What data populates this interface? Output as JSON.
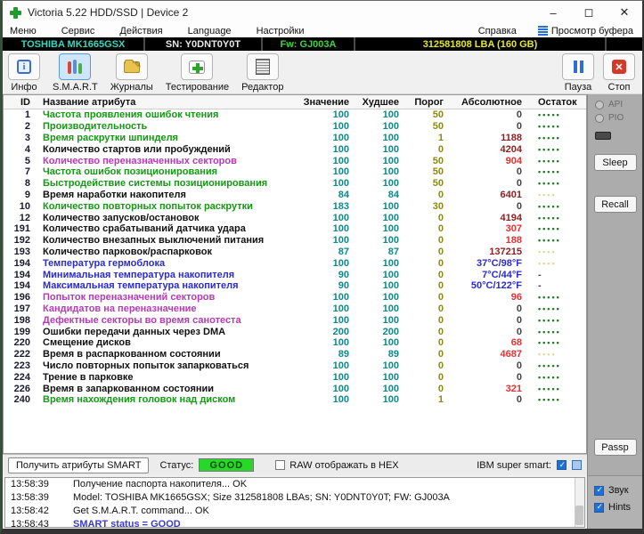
{
  "window": {
    "title": "Victoria 5.22 HDD/SSD | Device 2",
    "minimize": "–",
    "maximize": "◻",
    "close": "✕"
  },
  "menu": {
    "items": [
      "Меню",
      "Сервис",
      "Действия",
      "Language",
      "Настройки"
    ],
    "help": "Справка",
    "buffer_view": "Просмотр буфера"
  },
  "device_bar": {
    "model": "TOSHIBA MK1665GSX",
    "serial": "SN: Y0DNT0Y0T",
    "firmware": "Fw: GJ003A",
    "capacity": "312581808 LBA (160 GB)"
  },
  "toolbar": {
    "buttons": [
      {
        "label": "Инфо"
      },
      {
        "label": "S.M.A.R.T",
        "selected": true
      },
      {
        "label": "Журналы"
      },
      {
        "label": "Тестирование"
      },
      {
        "label": "Редактор"
      }
    ],
    "pause_label": "Пауза",
    "stop_label": "Стоп"
  },
  "smart_table": {
    "columns": [
      "ID",
      "Название атрибута",
      "Значение",
      "Худшее",
      "Порог",
      "Абсолютное",
      "Остаток"
    ],
    "rows": [
      {
        "id": 1,
        "name": "Частота проявления ошибок чтения",
        "name_color": "green",
        "value": 100,
        "worst": 100,
        "threshold": 50,
        "absolute": "0",
        "abs_color": "dark",
        "remain": "g5"
      },
      {
        "id": 2,
        "name": "Производительность",
        "name_color": "green",
        "value": 100,
        "worst": 100,
        "threshold": 50,
        "absolute": "0",
        "abs_color": "dark",
        "remain": "g5"
      },
      {
        "id": 3,
        "name": "Время раскрутки шпинделя",
        "name_color": "green",
        "value": 100,
        "worst": 100,
        "threshold": 1,
        "absolute": "1188",
        "abs_color": "maroon",
        "remain": "g5"
      },
      {
        "id": 4,
        "name": "Количество стартов или пробуждений",
        "name_color": "black",
        "value": 100,
        "worst": 100,
        "threshold": 0,
        "absolute": "4204",
        "abs_color": "maroon",
        "remain": "g5"
      },
      {
        "id": 5,
        "name": "Количество переназначенных секторов",
        "name_color": "magenta",
        "value": 100,
        "worst": 100,
        "threshold": 50,
        "absolute": "904",
        "abs_color": "red",
        "remain": "g5"
      },
      {
        "id": 7,
        "name": "Частота ошибок позиционирования",
        "name_color": "green",
        "value": 100,
        "worst": 100,
        "threshold": 50,
        "absolute": "0",
        "abs_color": "dark",
        "remain": "g5"
      },
      {
        "id": 8,
        "name": "Быстродействие системы позиционирования",
        "name_color": "green",
        "value": 100,
        "worst": 100,
        "threshold": 50,
        "absolute": "0",
        "abs_color": "dark",
        "remain": "g5"
      },
      {
        "id": 9,
        "name": "Время наработки накопителя",
        "name_color": "black",
        "value": 84,
        "worst": 84,
        "threshold": 0,
        "absolute": "6401",
        "abs_color": "maroon",
        "remain": "y4"
      },
      {
        "id": 10,
        "name": "Количество повторных попыток раскрутки",
        "name_color": "green",
        "value": 183,
        "worst": 100,
        "threshold": 30,
        "absolute": "0",
        "abs_color": "dark",
        "remain": "g5"
      },
      {
        "id": 12,
        "name": "Количество запусков/остановок",
        "name_color": "black",
        "value": 100,
        "worst": 100,
        "threshold": 0,
        "absolute": "4194",
        "abs_color": "maroon",
        "remain": "g5"
      },
      {
        "id": 191,
        "name": "Количество срабатываний датчика удара",
        "name_color": "black",
        "value": 100,
        "worst": 100,
        "threshold": 0,
        "absolute": "307",
        "abs_color": "red",
        "remain": "g5"
      },
      {
        "id": 192,
        "name": "Количество внезапных выключений питания",
        "name_color": "black",
        "value": 100,
        "worst": 100,
        "threshold": 0,
        "absolute": "188",
        "abs_color": "red",
        "remain": "g5"
      },
      {
        "id": 193,
        "name": "Количество парковок/распарковок",
        "name_color": "black",
        "value": 87,
        "worst": 87,
        "threshold": 0,
        "absolute": "137215",
        "abs_color": "maroon",
        "remain": "y4"
      },
      {
        "id": 194,
        "name": "Температура гермоблока",
        "name_color": "blue",
        "value": 100,
        "worst": 100,
        "threshold": 0,
        "absolute": "37°C/98°F",
        "abs_color": "blue",
        "remain": "y4"
      },
      {
        "id": 194,
        "name": "Минимальная температура накопителя",
        "name_color": "blue",
        "value": 90,
        "worst": 100,
        "threshold": 0,
        "absolute": "7°C/44°F",
        "abs_color": "blue",
        "remain": "dash"
      },
      {
        "id": 194,
        "name": "Максимальная температура накопителя",
        "name_color": "blue",
        "value": 90,
        "worst": 100,
        "threshold": 0,
        "absolute": "50°C/122°F",
        "abs_color": "blue",
        "remain": "dash"
      },
      {
        "id": 196,
        "name": "Попыток переназначений секторов",
        "name_color": "magenta",
        "value": 100,
        "worst": 100,
        "threshold": 0,
        "absolute": "96",
        "abs_color": "red",
        "remain": "g5"
      },
      {
        "id": 197,
        "name": "Кандидатов на переназначение",
        "name_color": "magenta",
        "value": 100,
        "worst": 100,
        "threshold": 0,
        "absolute": "0",
        "abs_color": "dark",
        "remain": "g5"
      },
      {
        "id": 198,
        "name": "Дефектные секторы во время санотеста",
        "name_color": "magenta",
        "value": 100,
        "worst": 100,
        "threshold": 0,
        "absolute": "0",
        "abs_color": "dark",
        "remain": "g5"
      },
      {
        "id": 199,
        "name": "Ошибки передачи данных через DMA",
        "name_color": "black",
        "value": 200,
        "worst": 200,
        "threshold": 0,
        "absolute": "0",
        "abs_color": "dark",
        "remain": "g5"
      },
      {
        "id": 220,
        "name": "Смещение дисков",
        "name_color": "black",
        "value": 100,
        "worst": 100,
        "threshold": 0,
        "absolute": "68",
        "abs_color": "red",
        "remain": "g5"
      },
      {
        "id": 222,
        "name": "Время в распаркованном состоянии",
        "name_color": "black",
        "value": 89,
        "worst": 89,
        "threshold": 0,
        "absolute": "4687",
        "abs_color": "red",
        "remain": "y4"
      },
      {
        "id": 223,
        "name": "Число повторных попыток запарковаться",
        "name_color": "black",
        "value": 100,
        "worst": 100,
        "threshold": 0,
        "absolute": "0",
        "abs_color": "dark",
        "remain": "g5"
      },
      {
        "id": 224,
        "name": "Трение в парковке",
        "name_color": "black",
        "value": 100,
        "worst": 100,
        "threshold": 0,
        "absolute": "0",
        "abs_color": "dark",
        "remain": "g5"
      },
      {
        "id": 226,
        "name": "Время в запаркованном состоянии",
        "name_color": "black",
        "value": 100,
        "worst": 100,
        "threshold": 0,
        "absolute": "321",
        "abs_color": "red",
        "remain": "g5"
      },
      {
        "id": 240,
        "name": "Время нахождения головок над диском",
        "name_color": "green",
        "value": 100,
        "worst": 100,
        "threshold": 1,
        "absolute": "0",
        "abs_color": "dark",
        "remain": "g5"
      }
    ]
  },
  "right_panel": {
    "radio_api": "API",
    "radio_pio": "PIO",
    "sleep_button": "Sleep",
    "recall_button": "Recall",
    "passp_button": "Passp",
    "sound_checkbox": "Звук",
    "hints_checkbox": "Hints"
  },
  "status_bar": {
    "get_smart_button": "Получить атрибуты SMART",
    "status_label": "Статус:",
    "status_value": "GOOD",
    "raw_hex_checkbox": "RAW отображать в HEX",
    "ibm_label": "IBM super smart:"
  },
  "log": {
    "lines": [
      {
        "time": "13:58:39",
        "text": "Получение паспорта накопителя... OK",
        "color": "black"
      },
      {
        "time": "13:58:39",
        "text": "Model: TOSHIBA MK1665GSX; Size 312581808 LBAs; SN: Y0DNT0Y0T; FW: GJ003A",
        "color": "black"
      },
      {
        "time": "13:58:42",
        "text": "Get S.M.A.R.T. command... OK",
        "color": "black"
      },
      {
        "time": "13:58:43",
        "text": "SMART status = GOOD",
        "color": "blue"
      }
    ]
  },
  "colors": {
    "model_text": "#35d9c0",
    "firmware_text": "#3ed43e",
    "capacity_text": "#e6e62e",
    "status_good_bg": "#28d828",
    "checkbox_blue": "#1f6fd4",
    "remain_green_dots": "#1d7a1d",
    "remain_yellow_dots": "#e5d79b",
    "selected_tool_bg": "#cfe6f8"
  }
}
